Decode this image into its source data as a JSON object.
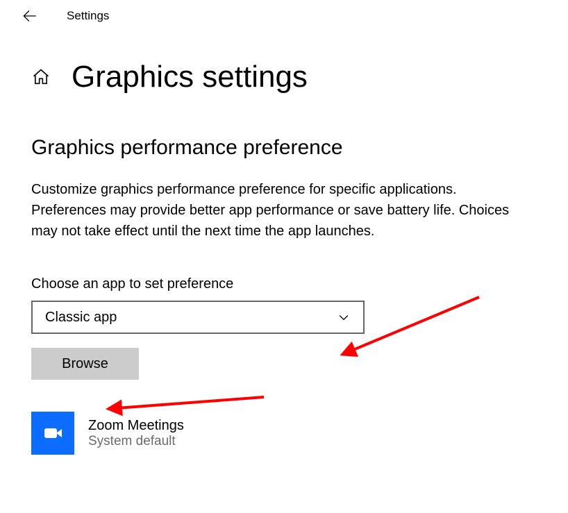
{
  "topbar": {
    "title": "Settings"
  },
  "page": {
    "title": "Graphics settings"
  },
  "section": {
    "title": "Graphics performance preference",
    "description": "Customize graphics performance preference for specific applications. Preferences may provide better app performance or save battery life. Choices may not take effect until the next time the app launches."
  },
  "chooser": {
    "label": "Choose an app to set preference",
    "selected": "Classic app",
    "browse_label": "Browse"
  },
  "apps": [
    {
      "name": "Zoom Meetings",
      "status": "System default"
    }
  ]
}
